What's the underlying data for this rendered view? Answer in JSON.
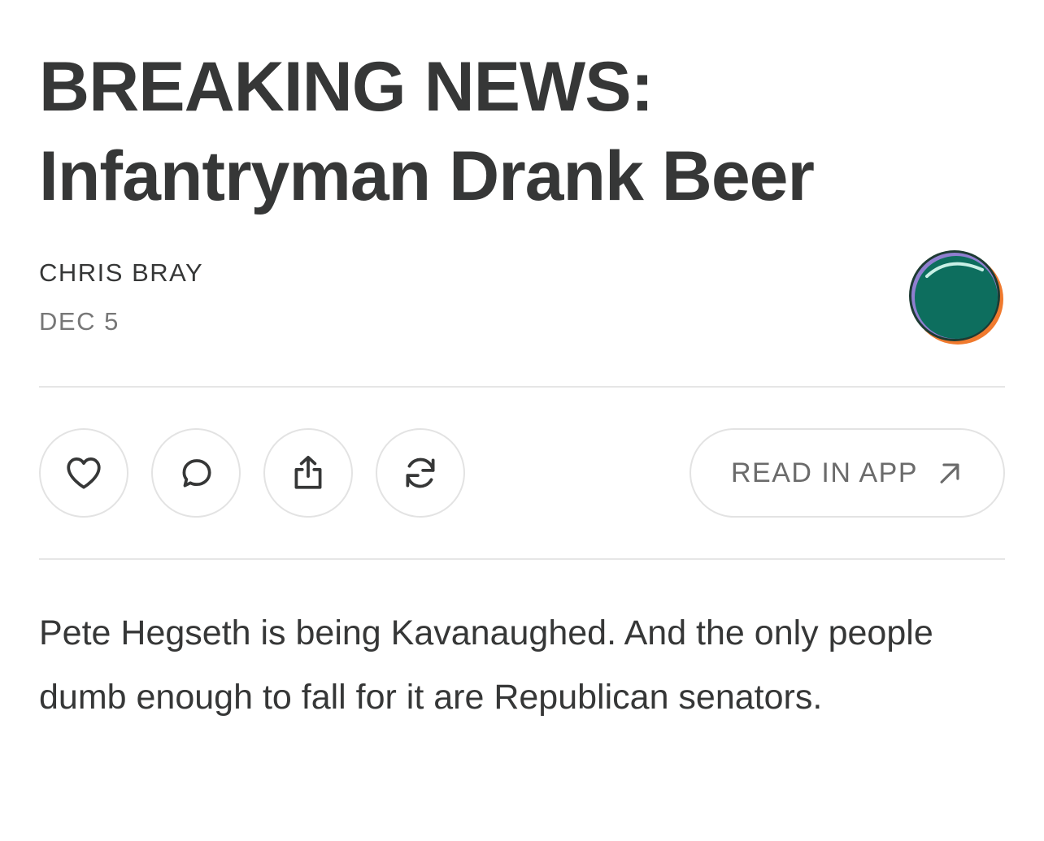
{
  "post": {
    "title_line1": "BREAKING NEWS:",
    "title_line2": "Infantryman Drank Beer",
    "author": "CHRIS BRAY",
    "date": "DEC 5",
    "body": "Pete Hegseth is being Kavanaughed. And the only people dumb enough to fall for it are Republican senators."
  },
  "actions": {
    "icons": [
      "heart-icon",
      "comment-icon",
      "share-icon",
      "restack-icon"
    ],
    "read_in_app_label": "READ IN APP",
    "read_in_app_icon": "arrow-up-right-icon"
  },
  "colors": {
    "text": "#363737",
    "muted": "#777777",
    "border": "#e3e3e3",
    "logo_green": "#0d6e5e",
    "logo_orange": "#f07a2e",
    "logo_yellow": "#f6b43b",
    "logo_purple": "#8f7fd0"
  }
}
